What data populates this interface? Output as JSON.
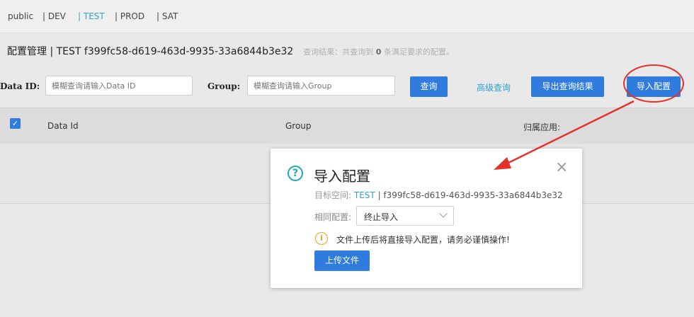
{
  "namespaces": [
    {
      "label": "public",
      "active": false
    },
    {
      "label": "| DEV",
      "active": false
    },
    {
      "label": "| TEST",
      "active": true
    },
    {
      "label": "| PROD",
      "active": false
    },
    {
      "label": "| SAT",
      "active": false
    }
  ],
  "header": {
    "title": "配置管理 | TEST f399fc58-d619-463d-9935-33a6844b3e32",
    "result_prefix": "查询结果：共查询到",
    "result_count": "0",
    "result_suffix": "条满足要求的配置。"
  },
  "search": {
    "dataid_label": "Data ID:",
    "dataid_placeholder": "模糊查询请输入Data ID",
    "group_label": "Group:",
    "group_placeholder": "模糊查询请输入Group",
    "query_button": "查询",
    "advanced_link": "高级查询",
    "export_button": "导出查询结果",
    "import_button": "导入配置"
  },
  "table": {
    "columns": [
      "Data Id",
      "Group",
      "归属应用:"
    ],
    "checkbox_mark": "✓"
  },
  "dialog": {
    "title": "导入配置",
    "target_label": "目标空间:",
    "target_namespace": "TEST",
    "target_id": "| f399fc58-d619-463d-9935-33a6844b3e32",
    "same_config_label": "相同配置:",
    "same_config_value": "终止导入",
    "warning": "文件上传后将直接导入配置，请务必谨慎操作!",
    "upload_button": "上传文件",
    "close_glyph": "×",
    "question_glyph": "?",
    "warning_glyph": "i"
  },
  "colors": {
    "primary": "#2f7bde",
    "link": "#2ea1d8",
    "annotation": "#e5312b"
  }
}
